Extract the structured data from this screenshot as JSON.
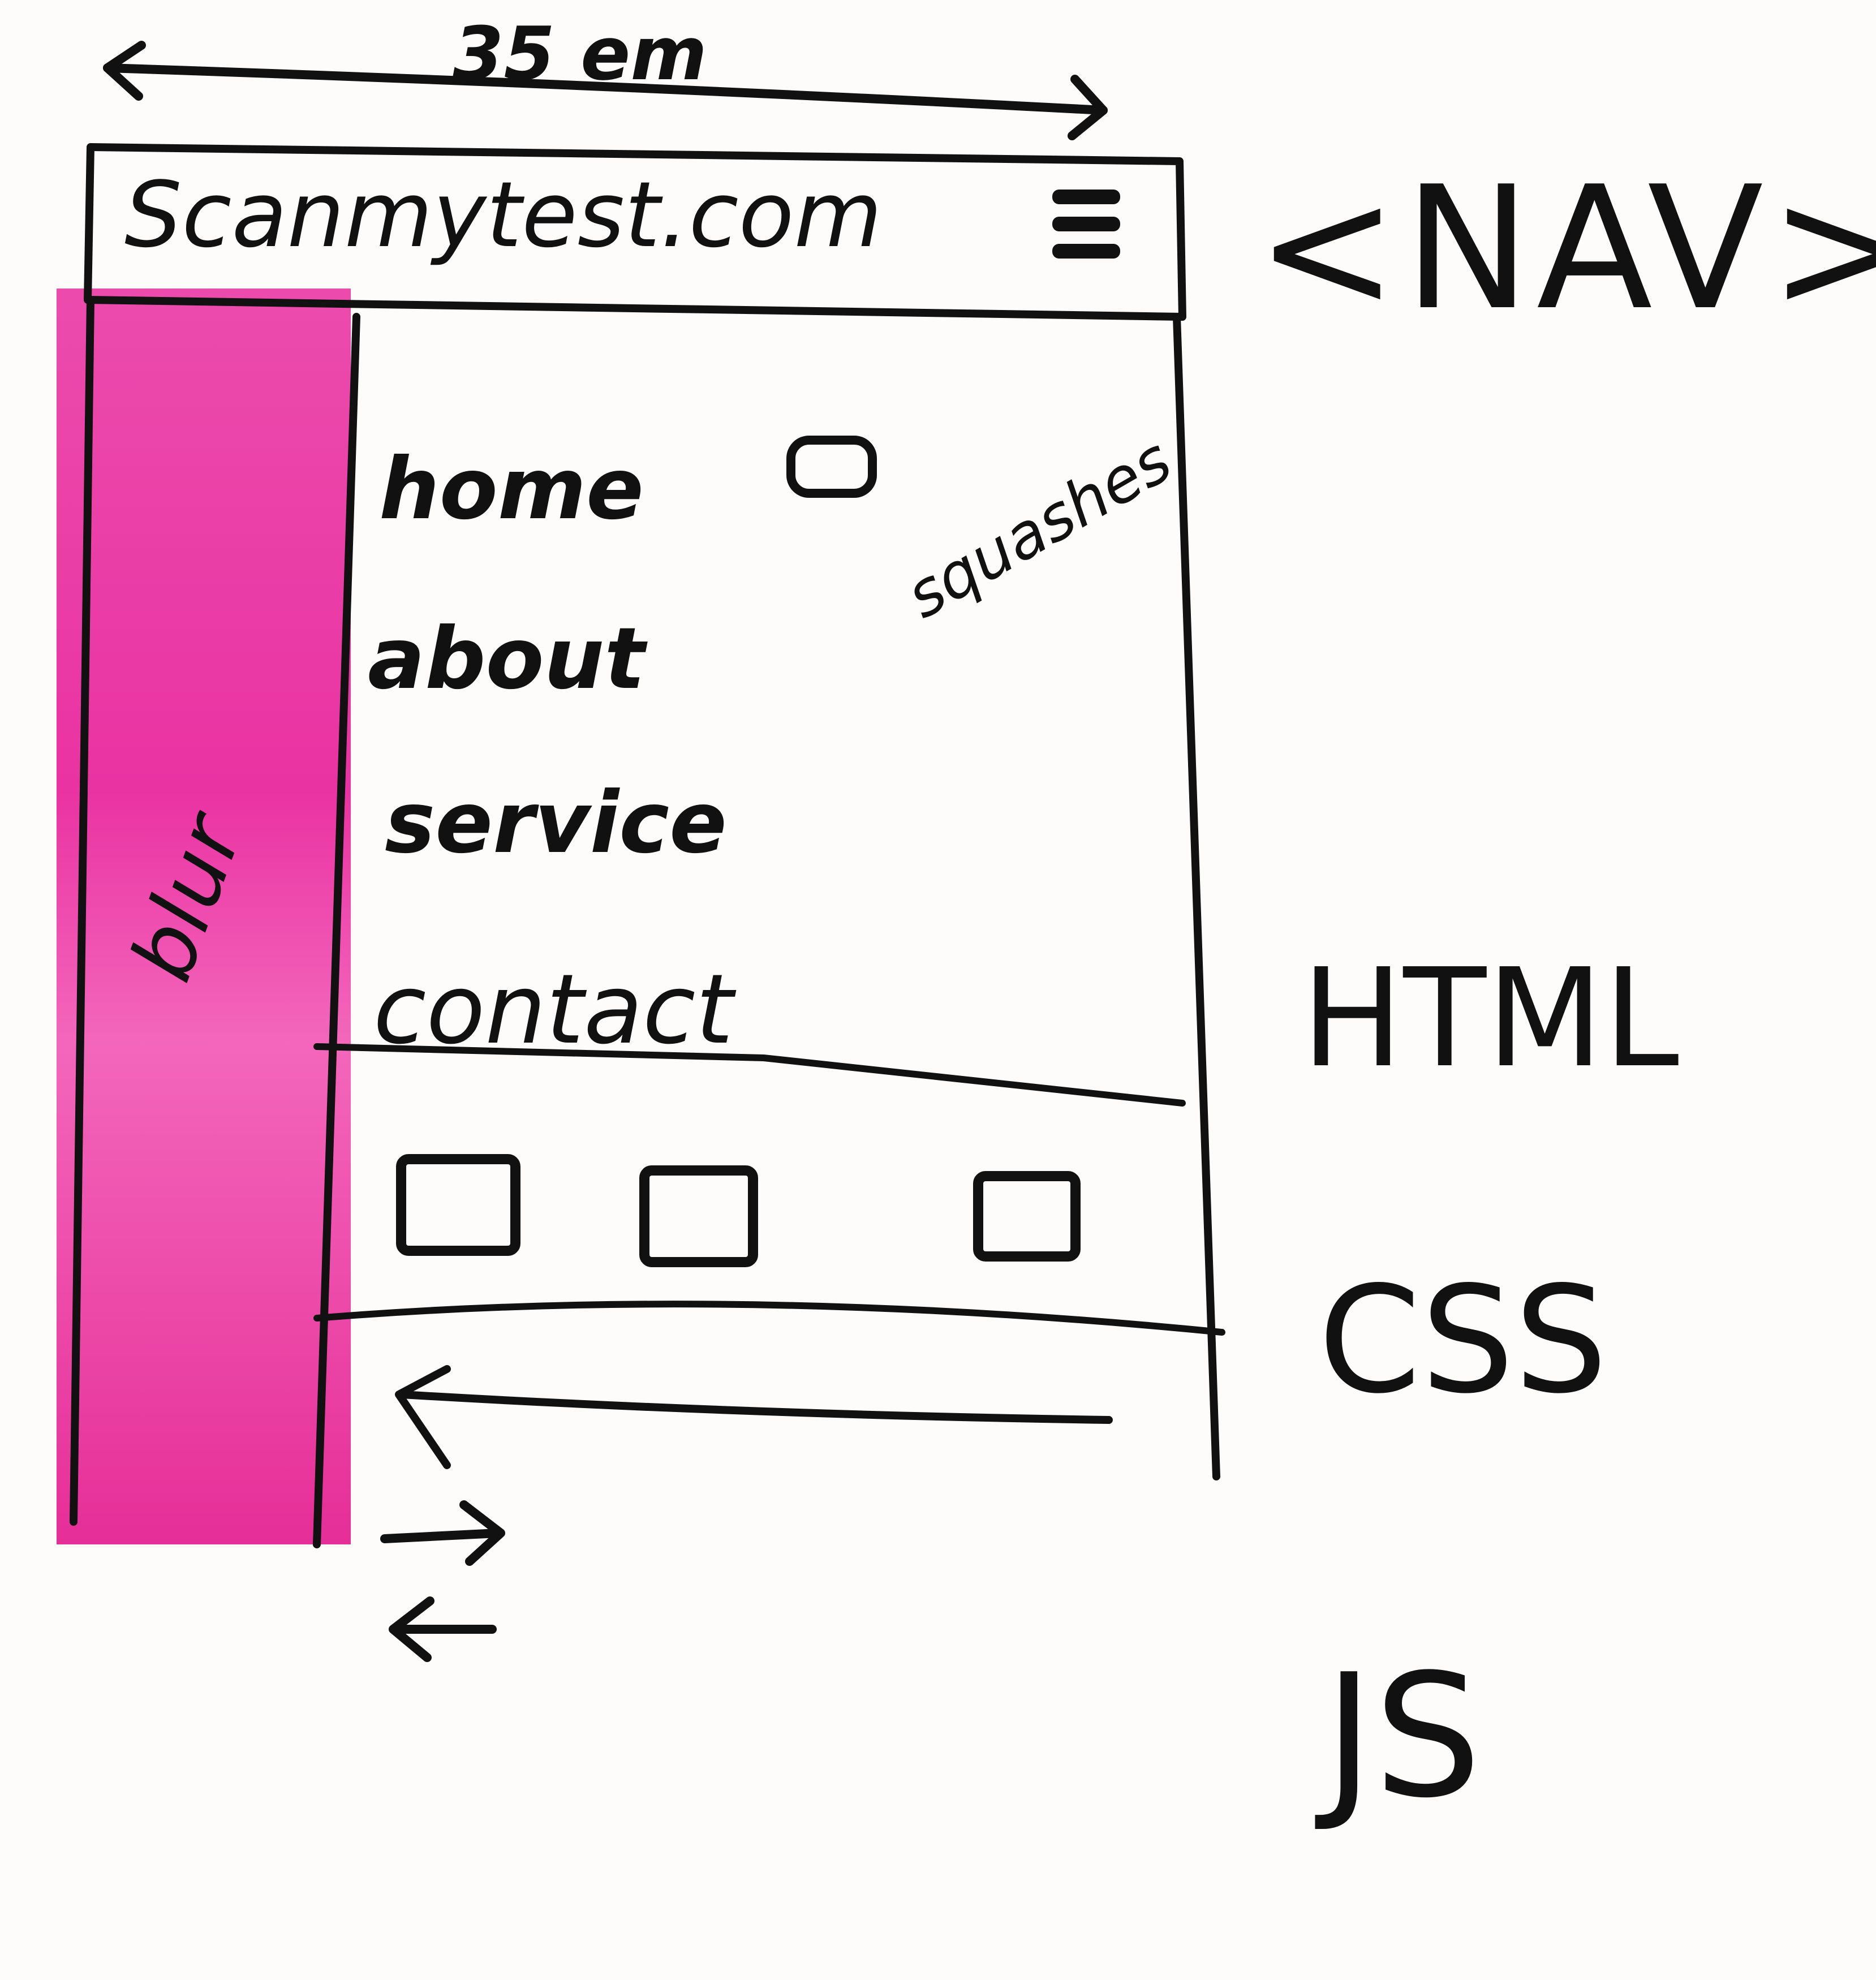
{
  "annotation": {
    "width_label": "35 em",
    "nav_tag": "<NAV>",
    "squash_note": "squashes",
    "blur_note": "blur"
  },
  "nav": {
    "logo": "Scanmytest.com",
    "menu_icon": "hamburger-icon"
  },
  "menu": {
    "items": [
      "home",
      "about",
      "service",
      "contact"
    ],
    "toggle_icon": "toggle-switch-icon"
  },
  "footer_bar": {
    "box_count": 3
  },
  "navigation_arrows": [
    "arrow-left-icon",
    "arrow-right-icon"
  ],
  "stack": [
    "HTML",
    "CSS",
    "JS"
  ],
  "colors": {
    "sidebar": "#e8219a",
    "ink": "#111111",
    "paper": "#fdfcfb"
  }
}
